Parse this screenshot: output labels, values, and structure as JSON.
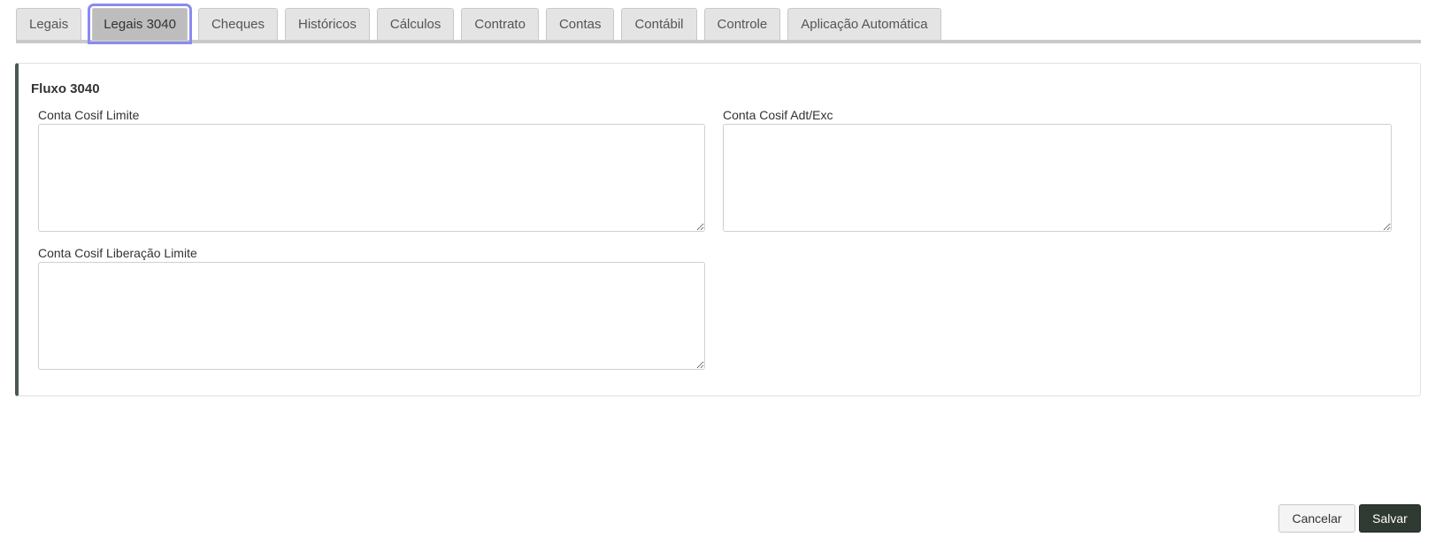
{
  "tabs": [
    {
      "label": "Legais",
      "active": false
    },
    {
      "label": "Legais 3040",
      "active": true
    },
    {
      "label": "Cheques",
      "active": false
    },
    {
      "label": "Históricos",
      "active": false
    },
    {
      "label": "Cálculos",
      "active": false
    },
    {
      "label": "Contrato",
      "active": false
    },
    {
      "label": "Contas",
      "active": false
    },
    {
      "label": "Contábil",
      "active": false
    },
    {
      "label": "Controle",
      "active": false
    },
    {
      "label": "Aplicação Automática",
      "active": false
    }
  ],
  "section": {
    "title": "Fluxo 3040",
    "fields": {
      "limite": {
        "label": "Conta Cosif Limite",
        "value": ""
      },
      "adt_exc": {
        "label": "Conta Cosif Adt/Exc",
        "value": ""
      },
      "liberacao_limite": {
        "label": "Conta Cosif Liberação Limite",
        "value": ""
      }
    }
  },
  "actions": {
    "cancel_label": "Cancelar",
    "save_label": "Salvar"
  },
  "colors": {
    "active_tab_outline": "#8a8af0",
    "panel_accent": "#4a5a50",
    "save_button": "#2f3a33"
  }
}
